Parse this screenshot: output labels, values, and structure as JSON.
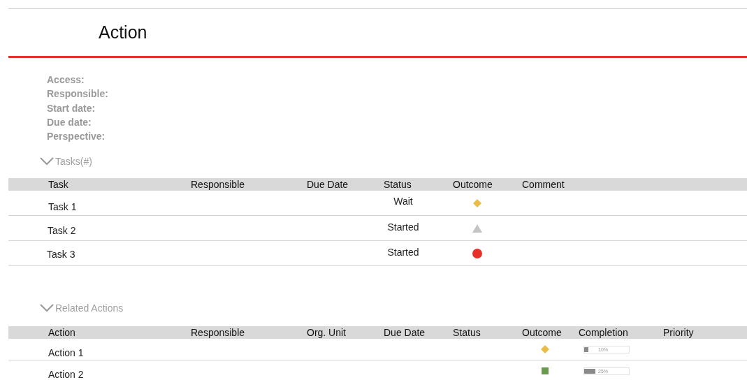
{
  "title": "Action",
  "fields": [
    "Access:",
    "Responsible:",
    "Start date:",
    "Due date:",
    "Perspective:"
  ],
  "tasks": {
    "heading": "Tasks(#)",
    "expanded": true,
    "columns": [
      "Task",
      "Responsible",
      "Due Date",
      "Status",
      "Outcome",
      "Comment"
    ],
    "rows": [
      {
        "task": "Task 1",
        "status": "Wait",
        "outcome": {
          "kind": "diamond",
          "color": "#e8bd4a"
        }
      },
      {
        "task": "Task 2",
        "status": "Started",
        "outcome": {
          "kind": "triangle",
          "color": "#c4c4c4"
        }
      },
      {
        "task": "Task 3",
        "status": "Started",
        "outcome": {
          "kind": "circle",
          "color": "#e8302a"
        }
      }
    ]
  },
  "related_actions": {
    "heading": "Related Actions",
    "expanded": true,
    "columns": [
      "Action",
      "Responsible",
      "Org. Unit",
      "Due Date",
      "Status",
      "Outcome",
      "Completion",
      "Priority"
    ],
    "rows": [
      {
        "action": "Action 1",
        "outcome": {
          "kind": "diamond",
          "color": "#e8bd4a"
        },
        "completion": {
          "level": 0.1,
          "label": "10%"
        }
      },
      {
        "action": "Action 2",
        "outcome": {
          "kind": "square",
          "color": "#6a9a4c"
        },
        "completion": {
          "level": 0.25,
          "label": "25%"
        }
      }
    ]
  }
}
